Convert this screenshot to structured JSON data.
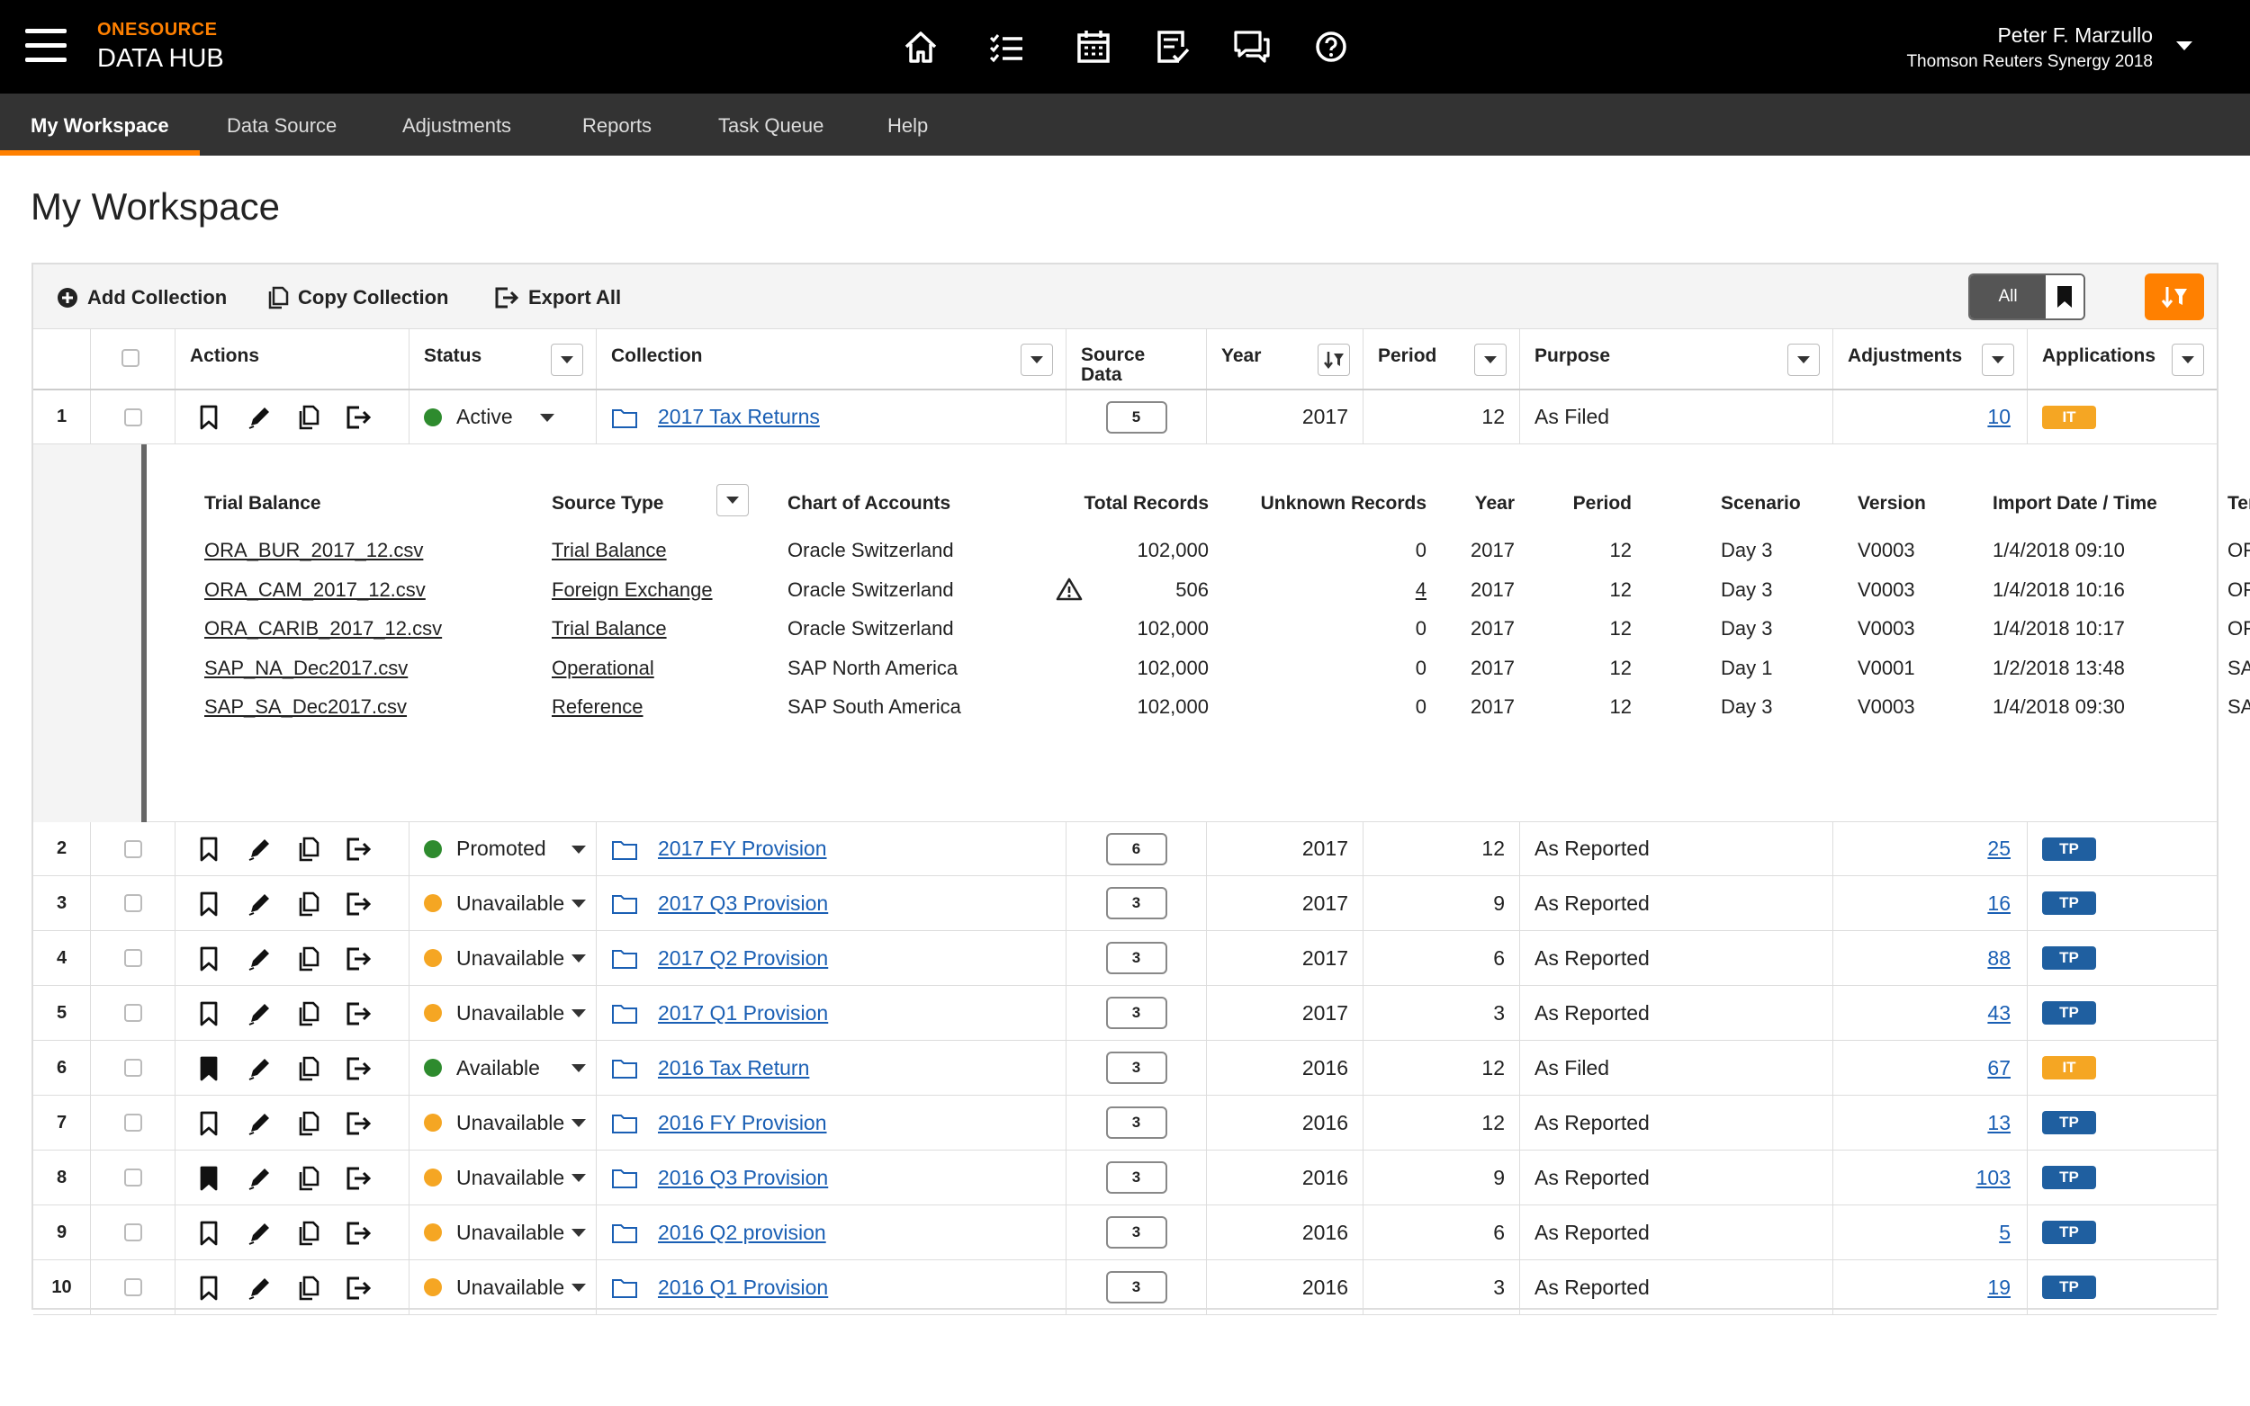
{
  "header": {
    "brand_top": "ONESOURCE",
    "brand_bottom": "DATA HUB",
    "user_name": "Peter F. Marzullo",
    "user_org": "Thomson Reuters Synergy 2018",
    "icons": [
      "home-icon",
      "task-list-icon",
      "calendar-icon",
      "review-icon",
      "chat-icon",
      "help-icon"
    ]
  },
  "nav": {
    "tabs": [
      {
        "label": "My Workspace"
      },
      {
        "label": "Data Source"
      },
      {
        "label": "Adjustments"
      },
      {
        "label": "Reports"
      },
      {
        "label": "Task Queue"
      },
      {
        "label": "Help"
      }
    ]
  },
  "page": {
    "title": "My Workspace"
  },
  "toolbar": {
    "add_label": "Add Collection",
    "copy_label": "Copy Collection",
    "export_label": "Export All",
    "seg_all": "All"
  },
  "columns": {
    "actions": "Actions",
    "status": "Status",
    "collection": "Collection",
    "source_data_1": "Source",
    "source_data_2": "Data",
    "year": "Year",
    "period": "Period",
    "purpose": "Purpose",
    "adjustments": "Adjustments",
    "applications": "Applications"
  },
  "rows": [
    {
      "idx": "1",
      "status": "Active",
      "status_color": "#2e8b2e",
      "collection": "2017 Tax Returns",
      "source": "5",
      "year": "2017",
      "period": "12",
      "purpose": "As Filed",
      "adjustments": "10",
      "app": "IT",
      "bookmarked": false
    },
    {
      "idx": "2",
      "status": "Promoted",
      "status_color": "#2e8b2e",
      "collection": "2017 FY Provision",
      "source": "6",
      "year": "2017",
      "period": "12",
      "purpose": "As Reported",
      "adjustments": "25",
      "app": "TP",
      "bookmarked": false
    },
    {
      "idx": "3",
      "status": "Unavailable",
      "status_color": "#f5a623",
      "collection": "2017 Q3 Provision",
      "source": "3",
      "year": "2017",
      "period": "9",
      "purpose": "As Reported",
      "adjustments": "16",
      "app": "TP",
      "bookmarked": false
    },
    {
      "idx": "4",
      "status": "Unavailable",
      "status_color": "#f5a623",
      "collection": "2017 Q2 Provision",
      "source": "3",
      "year": "2017",
      "period": "6",
      "purpose": "As Reported",
      "adjustments": "88",
      "app": "TP",
      "bookmarked": false
    },
    {
      "idx": "5",
      "status": "Unavailable",
      "status_color": "#f5a623",
      "collection": "2017 Q1 Provision",
      "source": "3",
      "year": "2017",
      "period": "3",
      "purpose": "As Reported",
      "adjustments": "43",
      "app": "TP",
      "bookmarked": false
    },
    {
      "idx": "6",
      "status": "Available",
      "status_color": "#2e8b2e",
      "collection": "2016 Tax Return",
      "source": "3",
      "year": "2016",
      "period": "12",
      "purpose": "As Filed",
      "adjustments": "67",
      "app": "IT",
      "bookmarked": true
    },
    {
      "idx": "7",
      "status": "Unavailable",
      "status_color": "#f5a623",
      "collection": "2016 FY Provision",
      "source": "3",
      "year": "2016",
      "period": "12",
      "purpose": "As Reported",
      "adjustments": "13",
      "app": "TP",
      "bookmarked": false
    },
    {
      "idx": "8",
      "status": "Unavailable",
      "status_color": "#f5a623",
      "collection": "2016 Q3 Provision",
      "source": "3",
      "year": "2016",
      "period": "9",
      "purpose": "As Reported",
      "adjustments": "103",
      "app": "TP",
      "bookmarked": true
    },
    {
      "idx": "9",
      "status": "Unavailable",
      "status_color": "#f5a623",
      "collection": "2016 Q2 provision",
      "source": "3",
      "year": "2016",
      "period": "6",
      "purpose": "As Reported",
      "adjustments": "5",
      "app": "TP",
      "bookmarked": false
    },
    {
      "idx": "10",
      "status": "Unavailable",
      "status_color": "#f5a623",
      "collection": "2016 Q1 Provision",
      "source": "3",
      "year": "2016",
      "period": "3",
      "purpose": "As Reported",
      "adjustments": "19",
      "app": "TP",
      "bookmarked": false
    }
  ],
  "app_colors": {
    "IT": "#f5a623",
    "TP": "#1f5fa0"
  },
  "detail": {
    "headers": {
      "trial_balance": "Trial Balance",
      "source_type": "Source Type",
      "chart": "Chart of Accounts",
      "total": "Total Records",
      "unknown": "Unknown Records",
      "year": "Year",
      "period": "Period",
      "scenario": "Scenario",
      "version": "Version",
      "import": "Import Date / Time",
      "tenant": "Ter"
    },
    "rows": [
      {
        "file": "ORA_BUR_2017_12.csv",
        "type": "Trial Balance",
        "chart": "Oracle Switzerland",
        "total": "102,000",
        "unknown": "0",
        "warn": false,
        "year": "2017",
        "period": "12",
        "scenario": "Day 3",
        "version": "V0003",
        "date": "1/4/2018",
        "time": "09:10",
        "tenant": "OF"
      },
      {
        "file": "ORA_CAM_2017_12.csv",
        "type": "Foreign Exchange",
        "chart": "Oracle Switzerland",
        "total": "506",
        "unknown": "4",
        "warn": true,
        "year": "2017",
        "period": "12",
        "scenario": "Day 3",
        "version": "V0003",
        "date": "1/4/2018",
        "time": "10:16",
        "tenant": "OF"
      },
      {
        "file": "ORA_CARIB_2017_12.csv",
        "type": "Trial Balance",
        "chart": "Oracle Switzerland",
        "total": "102,000",
        "unknown": "0",
        "warn": false,
        "year": "2017",
        "period": "12",
        "scenario": "Day 3",
        "version": "V0003",
        "date": "1/4/2018",
        "time": "10:17",
        "tenant": "OF"
      },
      {
        "file": "SAP_NA_Dec2017.csv",
        "type": "Operational",
        "chart": "SAP North America",
        "total": "102,000",
        "unknown": "0",
        "warn": false,
        "year": "2017",
        "period": "12",
        "scenario": "Day 1",
        "version": "V0001",
        "date": "1/2/2018",
        "time": "13:48",
        "tenant": "SA"
      },
      {
        "file": "SAP_SA_Dec2017.csv",
        "type": "Reference",
        "chart": "SAP South America",
        "total": "102,000",
        "unknown": "0",
        "warn": false,
        "year": "2017",
        "period": "12",
        "scenario": "Day 3",
        "version": "V0003",
        "date": "1/4/2018",
        "time": "09:30",
        "tenant": "SA"
      }
    ]
  }
}
